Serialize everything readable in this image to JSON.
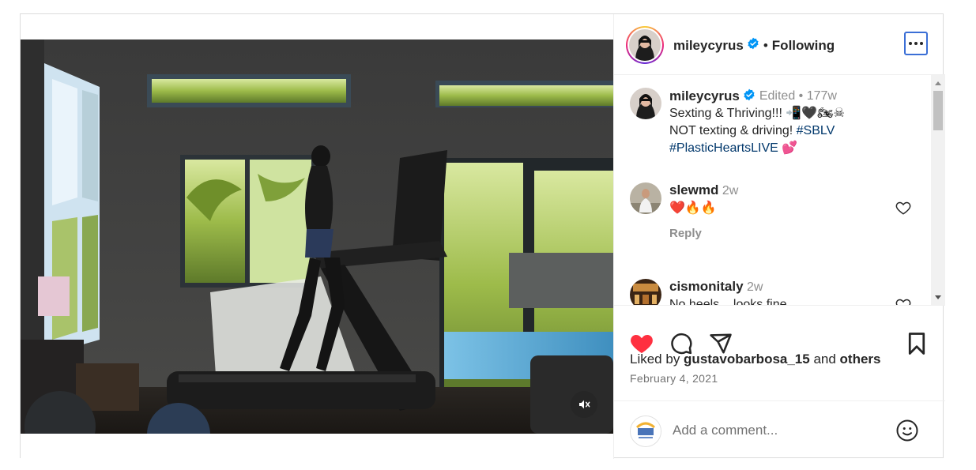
{
  "header": {
    "username": "mileycyrus",
    "dot": "•",
    "follow_status": "Following"
  },
  "caption": {
    "username": "mileycyrus",
    "meta": "Edited •  177w",
    "line1": "Sexting & Thriving!!! 📲🖤🏍☠",
    "line2_text": "NOT texting & driving! ",
    "line2_tag": "#SBLV",
    "line3_tag": "#PlasticHeartsLIVE",
    "line3_emoji": " 💕"
  },
  "comments": [
    {
      "username": "slewmd",
      "age": "2w",
      "text": "❤️🔥🔥",
      "reply_label": "Reply"
    },
    {
      "username": "cismonitaly",
      "age": "2w",
      "text": "No heels....looks fine."
    }
  ],
  "likes": {
    "prefix": "Liked by ",
    "user": "gustavobarbosa_15",
    "middle": " and ",
    "others": "others"
  },
  "date": "February 4, 2021",
  "add_comment": {
    "placeholder": "Add a comment..."
  },
  "colors": {
    "like_red": "#ff3040",
    "verified_blue": "#0095f6",
    "hashtag_blue": "#00376b",
    "more_button_focus": "#3b6fd6"
  },
  "icons": [
    "verified-icon",
    "more-options-icon",
    "heart-icon",
    "comment-icon",
    "share-icon",
    "bookmark-icon",
    "mute-icon",
    "emoji-icon"
  ]
}
